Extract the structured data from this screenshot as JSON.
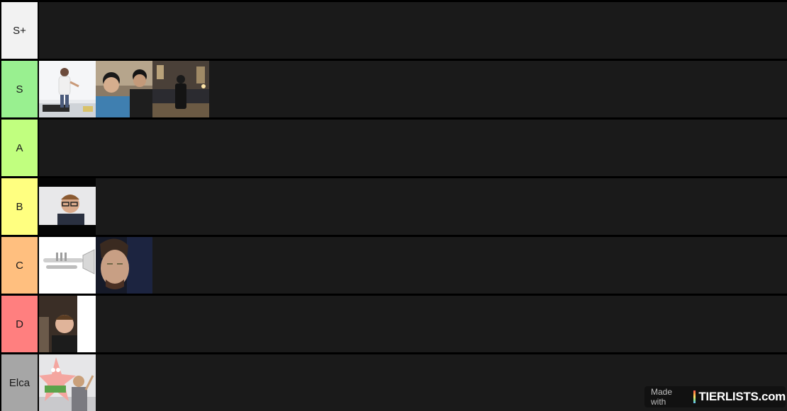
{
  "tiers": [
    {
      "label": "S+",
      "color": "#f2f2f2"
    },
    {
      "label": "S",
      "color": "#99f090"
    },
    {
      "label": "A",
      "color": "#c1ff7f"
    },
    {
      "label": "B",
      "color": "#ffff80"
    },
    {
      "label": "C",
      "color": "#ffbf7f"
    },
    {
      "label": "D",
      "color": "#ff7f7f"
    },
    {
      "label": "Elca",
      "color": "#a6a6a6"
    }
  ],
  "watermark": {
    "made_with": "Made with",
    "brand": "TIERLISTS.com"
  },
  "colors": {
    "row_background": "#1a1a1a",
    "separator": "#000000"
  }
}
